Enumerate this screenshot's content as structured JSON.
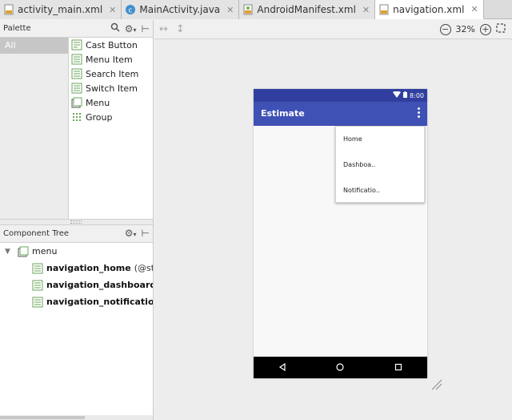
{
  "tabs": [
    {
      "label": "activity_main.xml",
      "icon": "xml-file-icon",
      "active": false
    },
    {
      "label": "MainActivity.java",
      "icon": "java-class-icon",
      "active": false
    },
    {
      "label": "AndroidManifest.xml",
      "icon": "manifest-icon",
      "active": false
    },
    {
      "label": "navigation.xml",
      "icon": "xml-file-icon",
      "active": true
    }
  ],
  "palette": {
    "title": "Palette",
    "categories": [
      "All"
    ],
    "items": [
      {
        "label": "Cast Button",
        "icon": "cast-button-icon"
      },
      {
        "label": "Menu Item",
        "icon": "menu-item-icon"
      },
      {
        "label": "Search Item",
        "icon": "search-item-icon"
      },
      {
        "label": "Switch Item",
        "icon": "switch-item-icon"
      },
      {
        "label": "Menu",
        "icon": "menu-icon"
      },
      {
        "label": "Group",
        "icon": "group-icon"
      }
    ]
  },
  "component_tree": {
    "title": "Component Tree",
    "root": "menu",
    "children": [
      {
        "id": "navigation_home",
        "ref": "(@string"
      },
      {
        "id": "navigation_dashboard",
        "ref": "(@"
      },
      {
        "id": "navigation_notifications",
        "ref": "("
      }
    ]
  },
  "design": {
    "zoom": "32%"
  },
  "phone": {
    "time": "8:00",
    "app_title": "Estimate",
    "menu_items": [
      "Home",
      "Dashboa..",
      "Notificatio.."
    ],
    "colors": {
      "status_bar": "#303f9f",
      "app_bar": "#3f51b5",
      "nav_bar": "#000000"
    }
  }
}
